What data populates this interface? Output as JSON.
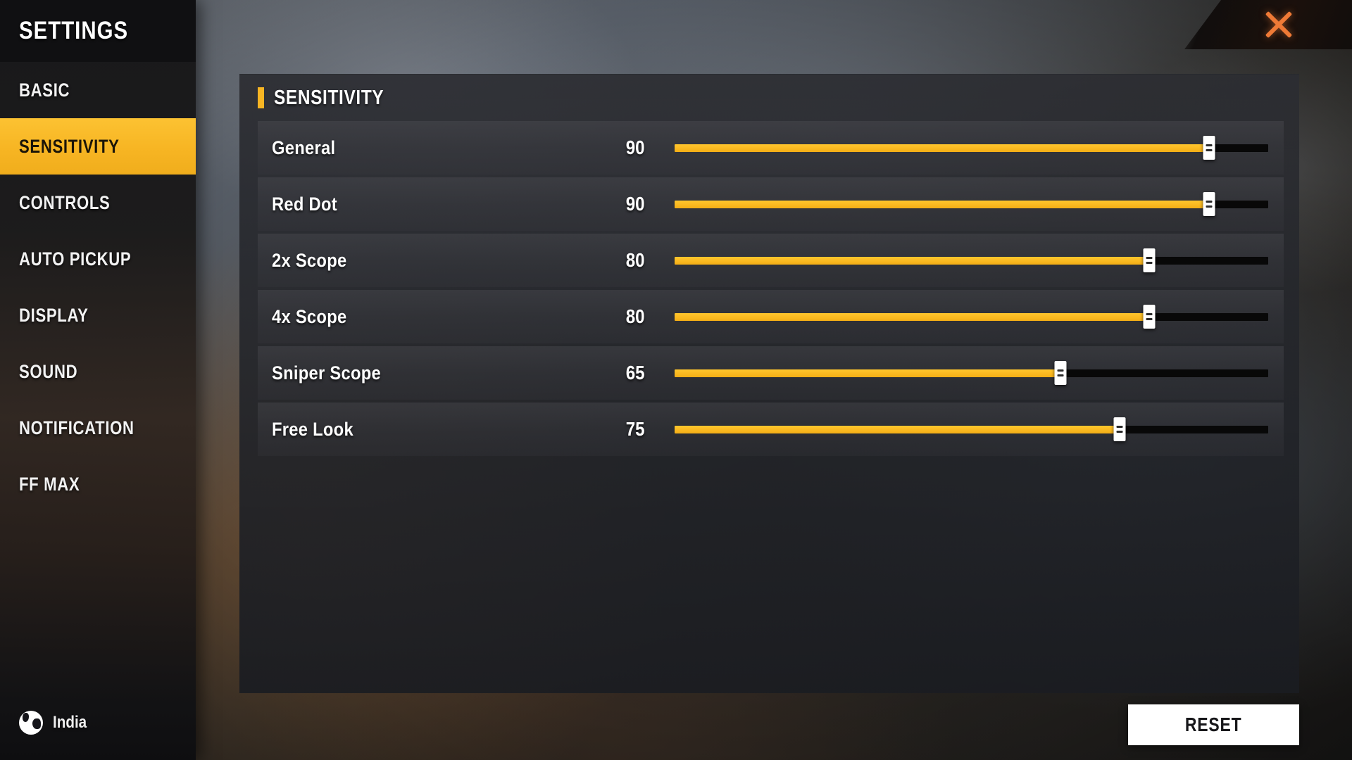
{
  "header": {
    "title": "SETTINGS",
    "close_icon": "close-icon"
  },
  "sidebar": {
    "items": [
      {
        "label": "BASIC",
        "active": false
      },
      {
        "label": "SENSITIVITY",
        "active": true
      },
      {
        "label": "CONTROLS",
        "active": false
      },
      {
        "label": "AUTO PICKUP",
        "active": false
      },
      {
        "label": "DISPLAY",
        "active": false
      },
      {
        "label": "SOUND",
        "active": false
      },
      {
        "label": "NOTIFICATION",
        "active": false
      },
      {
        "label": "FF MAX",
        "active": false
      }
    ],
    "region": {
      "icon": "globe-icon",
      "label": "India"
    }
  },
  "main": {
    "section_title": "SENSITIVITY",
    "accent_color": "#f7b523",
    "slider_min": 0,
    "slider_max": 100,
    "settings": [
      {
        "label": "General",
        "value": 90
      },
      {
        "label": "Red Dot",
        "value": 90
      },
      {
        "label": "2x Scope",
        "value": 80
      },
      {
        "label": "4x Scope",
        "value": 80
      },
      {
        "label": "Sniper Scope",
        "value": 65
      },
      {
        "label": "Free Look",
        "value": 75
      }
    ]
  },
  "footer": {
    "reset_label": "RESET"
  }
}
